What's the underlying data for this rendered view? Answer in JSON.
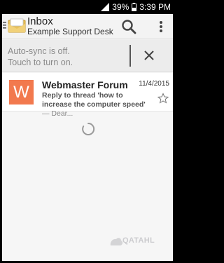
{
  "status_bar": {
    "battery": "39%",
    "time": "3:39 PM",
    "icons": [
      "signal-icon",
      "battery-icon"
    ]
  },
  "app_bar": {
    "title": "Inbox",
    "account": "Example Support Desk",
    "icons": [
      "menu-icon",
      "mail-app-icon",
      "search-icon",
      "overflow-menu-icon"
    ]
  },
  "sync_banner": {
    "line1": "Auto-sync is off.",
    "line2": "Touch to turn on.",
    "dismiss_icon": "close-icon"
  },
  "messages": [
    {
      "avatar_letter": "W",
      "avatar_color": "#f2794e",
      "sender": "Webmaster Forum",
      "date": "11/4/2015",
      "subject": "Reply to thread 'how to increase the computer speed'",
      "snippet": " — Dear...",
      "starred": false
    }
  ],
  "watermark": {
    "text": "QATAHL"
  },
  "colors": {
    "accent": "#f2794e",
    "banner_bg": "#ececec",
    "screen_bg": "#f6f6f6"
  }
}
